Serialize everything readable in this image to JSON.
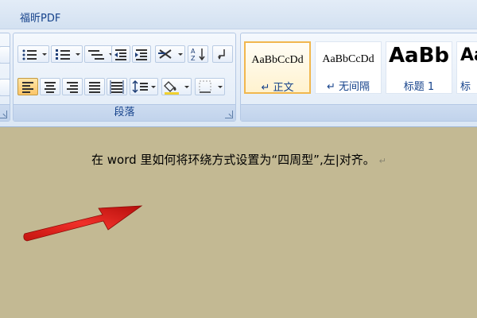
{
  "tabs": {
    "foxit_pdf": "福昕PDF"
  },
  "ribbon": {
    "paragraph_group": {
      "label": "段落"
    },
    "styles": [
      {
        "preview": "AaBbCcDd",
        "name": "↵ 正文",
        "selected": true
      },
      {
        "preview": "AaBbCcDd",
        "name": "↵ 无间隔",
        "selected": false
      },
      {
        "preview": "AaBb",
        "name": "标题 1",
        "selected": false
      },
      {
        "preview": "Aa",
        "name": "标",
        "selected": false
      }
    ]
  },
  "document": {
    "text_before_caret": "在 word 里如何将环绕方式设置为“四周型”,左",
    "text_after_caret": "对齐。",
    "paragraph_mark": "↵"
  },
  "colors": {
    "document_background": "#c3b993",
    "arrow": "#e0201b",
    "ribbon_text": "#15428b",
    "selected_style_border": "#f1b74e"
  }
}
